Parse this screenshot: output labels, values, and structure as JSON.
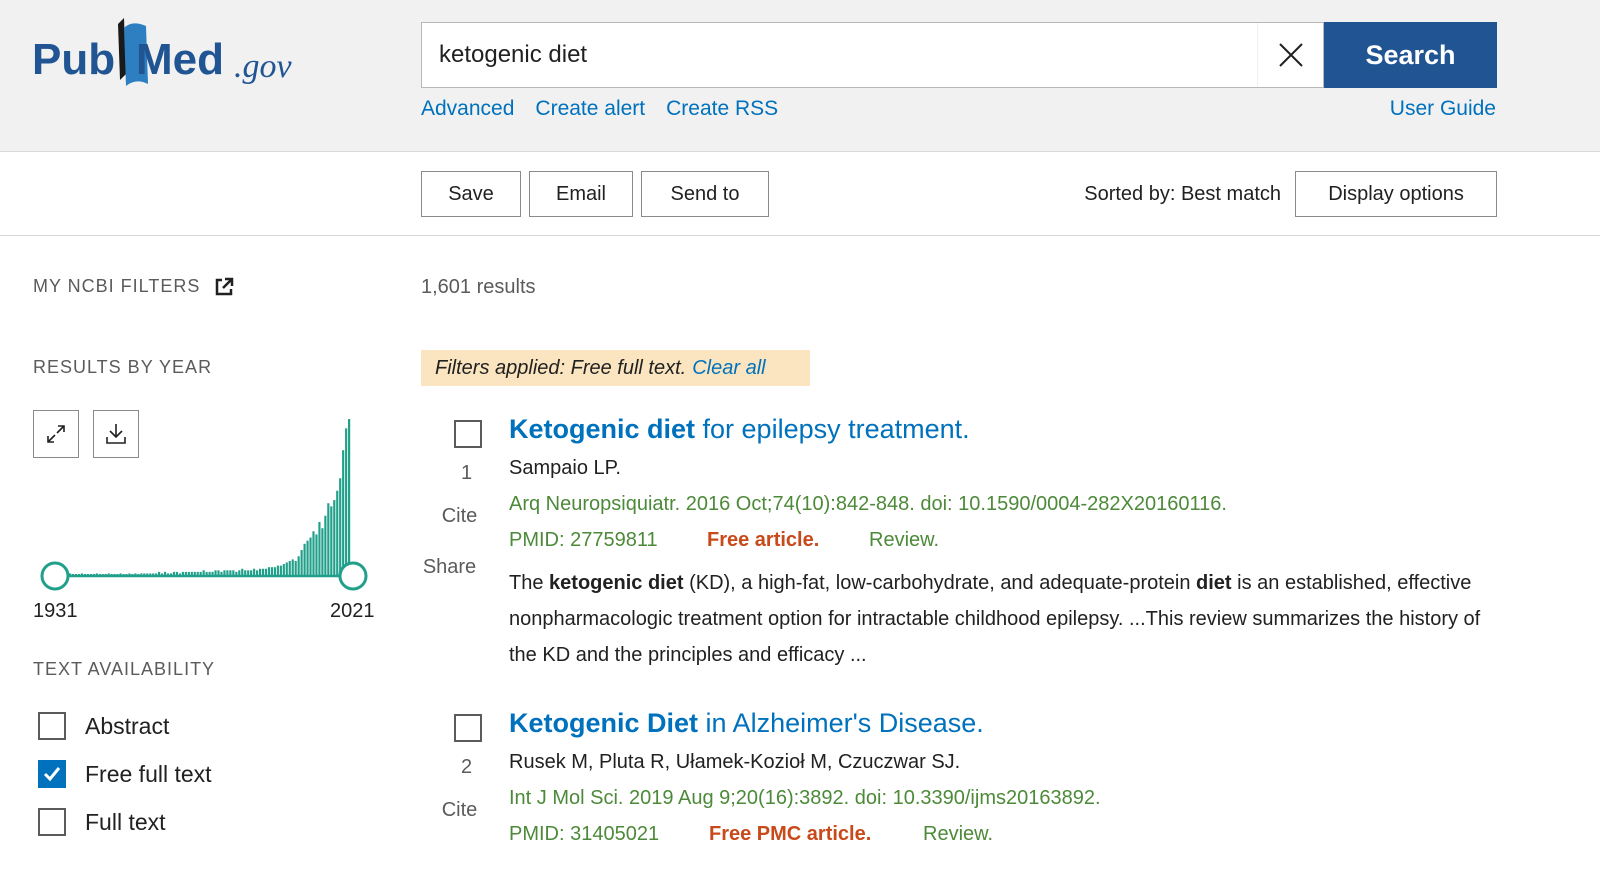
{
  "header": {
    "logo_text": "PubMed.gov",
    "search_value": "ketogenic diet",
    "search_button": "Search",
    "links": [
      "Advanced",
      "Create alert",
      "Create RSS"
    ],
    "user_guide": "User Guide"
  },
  "toolbar": {
    "save": "Save",
    "email": "Email",
    "send_to": "Send to",
    "sorted_by": "Sorted by: Best match",
    "display_options": "Display options"
  },
  "sidebar": {
    "my_ncbi_filters": "MY NCBI FILTERS",
    "results_by_year": "RESULTS BY YEAR",
    "year_start": "1931",
    "year_end": "2021",
    "text_availability": "TEXT AVAILABILITY",
    "filters": [
      {
        "label": "Abstract",
        "checked": false
      },
      {
        "label": "Free full text",
        "checked": true
      },
      {
        "label": "Full text",
        "checked": false
      }
    ]
  },
  "results": {
    "count": "1,601 results",
    "filters_applied": "Filters applied: Free full text.",
    "clear_all": "Clear all",
    "items": [
      {
        "number": "1",
        "cite": "Cite",
        "share": "Share",
        "title_bold": "Ketogenic diet",
        "title_rest": " for epilepsy treatment.",
        "authors": "Sampaio LP.",
        "citation": "Arq Neuropsiquiatr. 2016 Oct;74(10):842-848. doi: 10.1590/0004-282X20160116.",
        "pmid": "PMID: 27759811",
        "free": "Free article.",
        "pub_type": "Review.",
        "snippet": [
          {
            "t": "The ",
            "b": false
          },
          {
            "t": "ketogenic diet",
            "b": true
          },
          {
            "t": " (KD), a high-fat, low-carbohydrate, and adequate-protein ",
            "b": false
          },
          {
            "t": "diet",
            "b": true
          },
          {
            "t": " is an established, effective nonpharmacologic treatment option for intractable childhood epilepsy. ...This review summarizes the history of the KD and the principles and efficacy ...",
            "b": false
          }
        ]
      },
      {
        "number": "2",
        "cite": "Cite",
        "title_bold": "Ketogenic Diet",
        "title_rest": " in Alzheimer's Disease.",
        "authors": "Rusek M, Pluta R, Ułamek-Kozioł M, Czuczwar SJ.",
        "citation": "Int J Mol Sci. 2019 Aug 9;20(16):3892. doi: 10.3390/ijms20163892.",
        "pmid": "PMID: 31405021",
        "free": "Free PMC article.",
        "pub_type": "Review."
      }
    ]
  },
  "year_histogram": [
    1,
    0,
    0,
    0,
    1,
    0,
    0,
    0,
    0,
    1,
    0,
    0,
    0,
    1,
    0,
    0,
    0,
    1,
    0,
    0,
    1,
    0,
    1,
    0,
    1,
    1,
    1,
    1,
    1,
    1,
    2,
    1,
    2,
    1,
    1,
    2,
    2,
    1,
    2,
    2,
    2,
    2,
    2,
    2,
    2,
    3,
    2,
    2,
    2,
    3,
    3,
    2,
    3,
    3,
    3,
    3,
    2,
    3,
    4,
    3,
    3,
    3,
    4,
    3,
    4,
    4,
    4,
    5,
    5,
    5,
    6,
    6,
    7,
    8,
    9,
    10,
    9,
    12,
    16,
    20,
    22,
    24,
    28,
    26,
    34,
    30,
    38,
    46,
    44,
    48,
    54,
    62,
    80,
    94,
    100
  ],
  "colors": {
    "brand_blue": "#205493",
    "link_blue": "#0071bc",
    "green": "#4c8a39",
    "orange": "#c8491a",
    "teal": "#20a08a",
    "filter_bg": "#fae5c0"
  }
}
